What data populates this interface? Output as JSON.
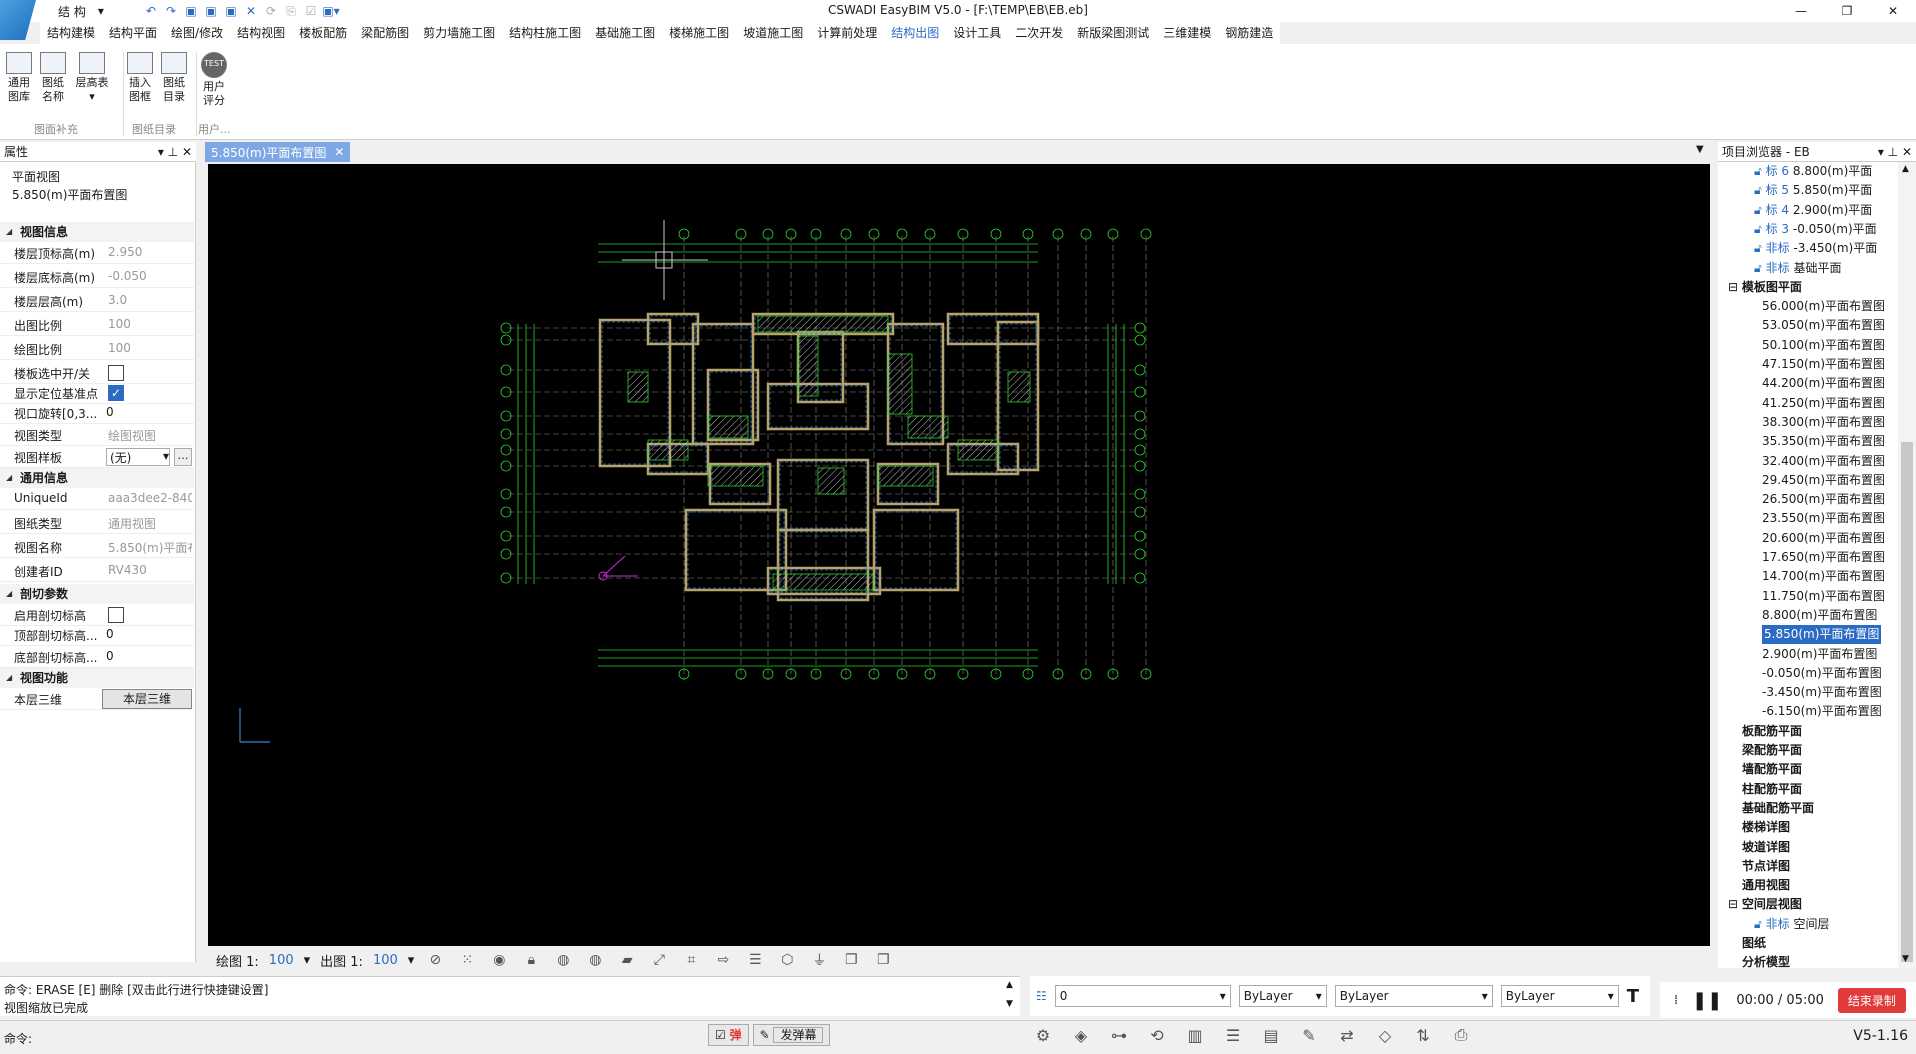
{
  "title": "CSWADI EasyBIM V5.0 - [F:\\TEMP\\EB\\EB.eb]",
  "quick_access": {
    "discipline": "结  构"
  },
  "menu": [
    "结构建模",
    "结构平面",
    "绘图/修改",
    "结构视图",
    "楼板配筋",
    "梁配筋图",
    "剪力墙施工图",
    "结构柱施工图",
    "基础施工图",
    "楼梯施工图",
    "坡道施工图",
    "计算前处理",
    "结构出图",
    "设计工具",
    "二次开发",
    "新版梁图测试",
    "三维建模",
    "钢筋建造"
  ],
  "ribbon": {
    "buttons": [
      {
        "l1": "通用",
        "l2": "图库"
      },
      {
        "l1": "图纸",
        "l2": "名称"
      },
      {
        "l1": "层高表",
        "l2": "▾"
      },
      {
        "l1": "插入",
        "l2": "图框"
      },
      {
        "l1": "图纸",
        "l2": "目录"
      },
      {
        "l1": "用户",
        "l2": "评分"
      }
    ],
    "groups": [
      "图面补充",
      "图纸目录",
      "用户..."
    ],
    "test_badge": "TEST"
  },
  "properties": {
    "header": "属性",
    "view_type_label": "平面视图",
    "view_name_label": "5.850(m)平面布置图",
    "sections": {
      "view_info": "视图信息",
      "general_info": "通用信息",
      "cut_params": "剖切参数",
      "view_func": "视图功能"
    },
    "rows": {
      "top_elev": {
        "k": "楼层顶标高(m)",
        "v": "2.950"
      },
      "bottom_elev": {
        "k": "楼层底标高(m)",
        "v": "-0.050"
      },
      "floor_height": {
        "k": "楼层层高(m)",
        "v": "3.0"
      },
      "output_scale": {
        "k": "出图比例",
        "v": "100"
      },
      "draw_scale": {
        "k": "绘图比例",
        "v": "100"
      },
      "slab_toggle": {
        "k": "楼板选中开/关"
      },
      "show_datum": {
        "k": "显示定位基准点"
      },
      "rotation": {
        "k": "视口旋转[0,3...",
        "v": "0"
      },
      "view_kind": {
        "k": "视图类型",
        "v": "绘图视图"
      },
      "view_template": {
        "k": "视图样板",
        "v": "(无)"
      },
      "unique_id": {
        "k": "UniqueId",
        "v": "aaa3dee2-840"
      },
      "sheet_type": {
        "k": "图纸类型",
        "v": "通用视图"
      },
      "view_name": {
        "k": "视图名称",
        "v": "5.850(m)平面布"
      },
      "creator": {
        "k": "创建者ID",
        "v": "RV430"
      },
      "enable_cut": {
        "k": "启用剖切标高"
      },
      "top_cut": {
        "k": "顶部剖切标高...",
        "v": "0"
      },
      "bottom_cut": {
        "k": "底部剖切标高...",
        "v": "0"
      },
      "floor_3d": {
        "k": "本层三维",
        "v": "本层三维"
      }
    }
  },
  "doc_tab": "5.850(m)平面布置图",
  "canvas_bar": {
    "draw_label": "绘图 1:",
    "draw_value": "100",
    "out_label": "出图 1:",
    "out_value": "100"
  },
  "browser": {
    "header": "项目浏览器 - EB",
    "std_levels": [
      {
        "tag": "标 6",
        "name": "8.800(m)平面"
      },
      {
        "tag": "标 5",
        "name": "5.850(m)平面"
      },
      {
        "tag": "标 4",
        "name": "2.900(m)平面"
      },
      {
        "tag": "标 3",
        "name": "-0.050(m)平面"
      },
      {
        "tag": "非标",
        "name": "-3.450(m)平面"
      },
      {
        "tag": "非标",
        "name": "基础平面"
      }
    ],
    "template_group": "模板图平面",
    "plans": [
      "56.000(m)平面布置图",
      "53.050(m)平面布置图",
      "50.100(m)平面布置图",
      "47.150(m)平面布置图",
      "44.200(m)平面布置图",
      "41.250(m)平面布置图",
      "38.300(m)平面布置图",
      "35.350(m)平面布置图",
      "32.400(m)平面布置图",
      "29.450(m)平面布置图",
      "26.500(m)平面布置图",
      "23.550(m)平面布置图",
      "20.600(m)平面布置图",
      "17.650(m)平面布置图",
      "14.700(m)平面布置图",
      "11.750(m)平面布置图",
      "8.800(m)平面布置图",
      "5.850(m)平面布置图",
      "2.900(m)平面布置图",
      "-0.050(m)平面布置图",
      "-3.450(m)平面布置图",
      "-6.150(m)平面布置图"
    ],
    "groups": [
      "板配筋平面",
      "梁配筋平面",
      "墙配筋平面",
      "柱配筋平面",
      "基础配筋平面",
      "楼梯详图",
      "坡道详图",
      "节点详图",
      "通用视图"
    ],
    "space_group": "空间层视图",
    "space_item": {
      "tag": "非标",
      "name": "空间层"
    },
    "tail": [
      "图纸",
      "分析模型"
    ]
  },
  "command": {
    "line1": "命令: ERASE [E] 删除 [双击此行进行快捷键设置]",
    "line2": "视图缩放已完成",
    "prompt": "命令:"
  },
  "layer": {
    "layer": "0",
    "color": "ByLayer",
    "linetype": "ByLayer",
    "lineweight": "ByLayer"
  },
  "recorder": {
    "time": "00:00 / 05:00",
    "stop": "结束录制"
  },
  "status": {
    "popup": "弹",
    "bullet": "发弹幕"
  },
  "version": "V5-1.16",
  "colors": {
    "accent": "#2c6bc4",
    "canvas": "#000000",
    "drawing": "#2bd12b",
    "record": "#e03a3a"
  }
}
